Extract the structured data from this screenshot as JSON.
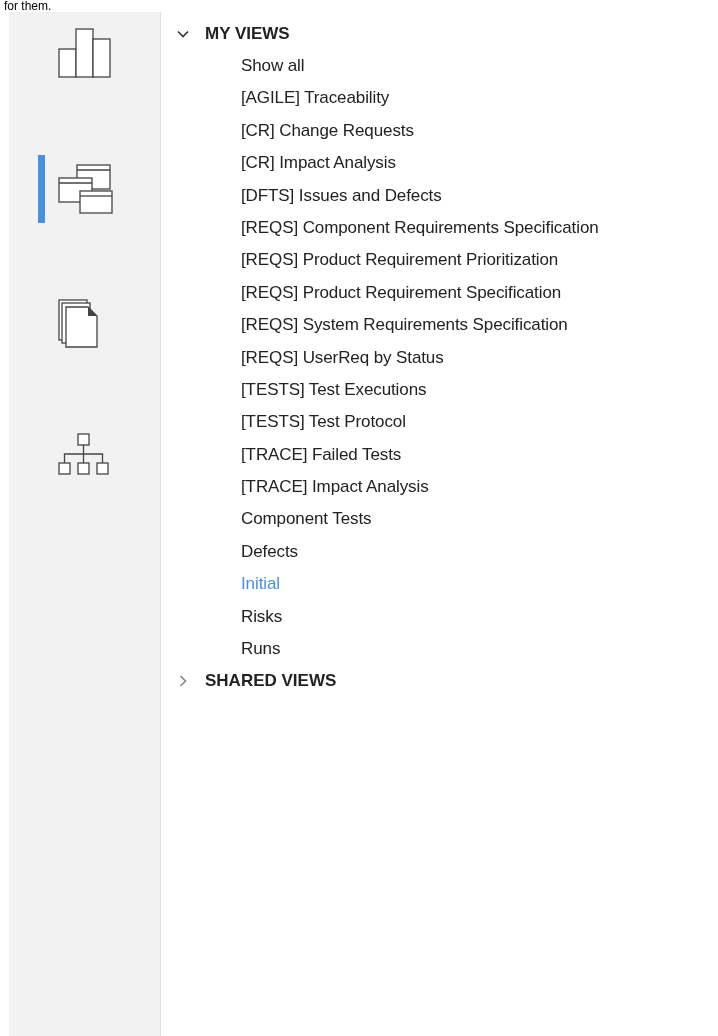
{
  "top_text": "for them.",
  "sidebar": {
    "items": [
      {
        "kind": "bars",
        "selected": false
      },
      {
        "kind": "windows",
        "selected": true
      },
      {
        "kind": "documents",
        "selected": false
      },
      {
        "kind": "hierarchy",
        "selected": false
      }
    ]
  },
  "tree": [
    {
      "label": "MY VIEWS",
      "expanded": true,
      "items": [
        {
          "label": "Show all",
          "selected": false
        },
        {
          "label": "[AGILE] Traceability",
          "selected": false
        },
        {
          "label": "[CR] Change Requests",
          "selected": false
        },
        {
          "label": "[CR] Impact Analysis",
          "selected": false
        },
        {
          "label": "[DFTS] Issues and Defects",
          "selected": false
        },
        {
          "label": "[REQS] Component Requirements Specification",
          "selected": false
        },
        {
          "label": "[REQS] Product Requirement Prioritization",
          "selected": false
        },
        {
          "label": "[REQS] Product Requirement Specification",
          "selected": false
        },
        {
          "label": "[REQS] System Requirements Specification",
          "selected": false
        },
        {
          "label": "[REQS] UserReq by Status",
          "selected": false
        },
        {
          "label": "[TESTS] Test Executions",
          "selected": false
        },
        {
          "label": "[TESTS] Test Protocol",
          "selected": false
        },
        {
          "label": "[TRACE] Failed Tests",
          "selected": false
        },
        {
          "label": "[TRACE] Impact Analysis",
          "selected": false
        },
        {
          "label": "Component Tests",
          "selected": false
        },
        {
          "label": "Defects",
          "selected": false
        },
        {
          "label": "Initial",
          "selected": true
        },
        {
          "label": "Risks",
          "selected": false
        },
        {
          "label": "Runs",
          "selected": false
        }
      ]
    },
    {
      "label": "SHARED VIEWS",
      "expanded": false
    }
  ]
}
